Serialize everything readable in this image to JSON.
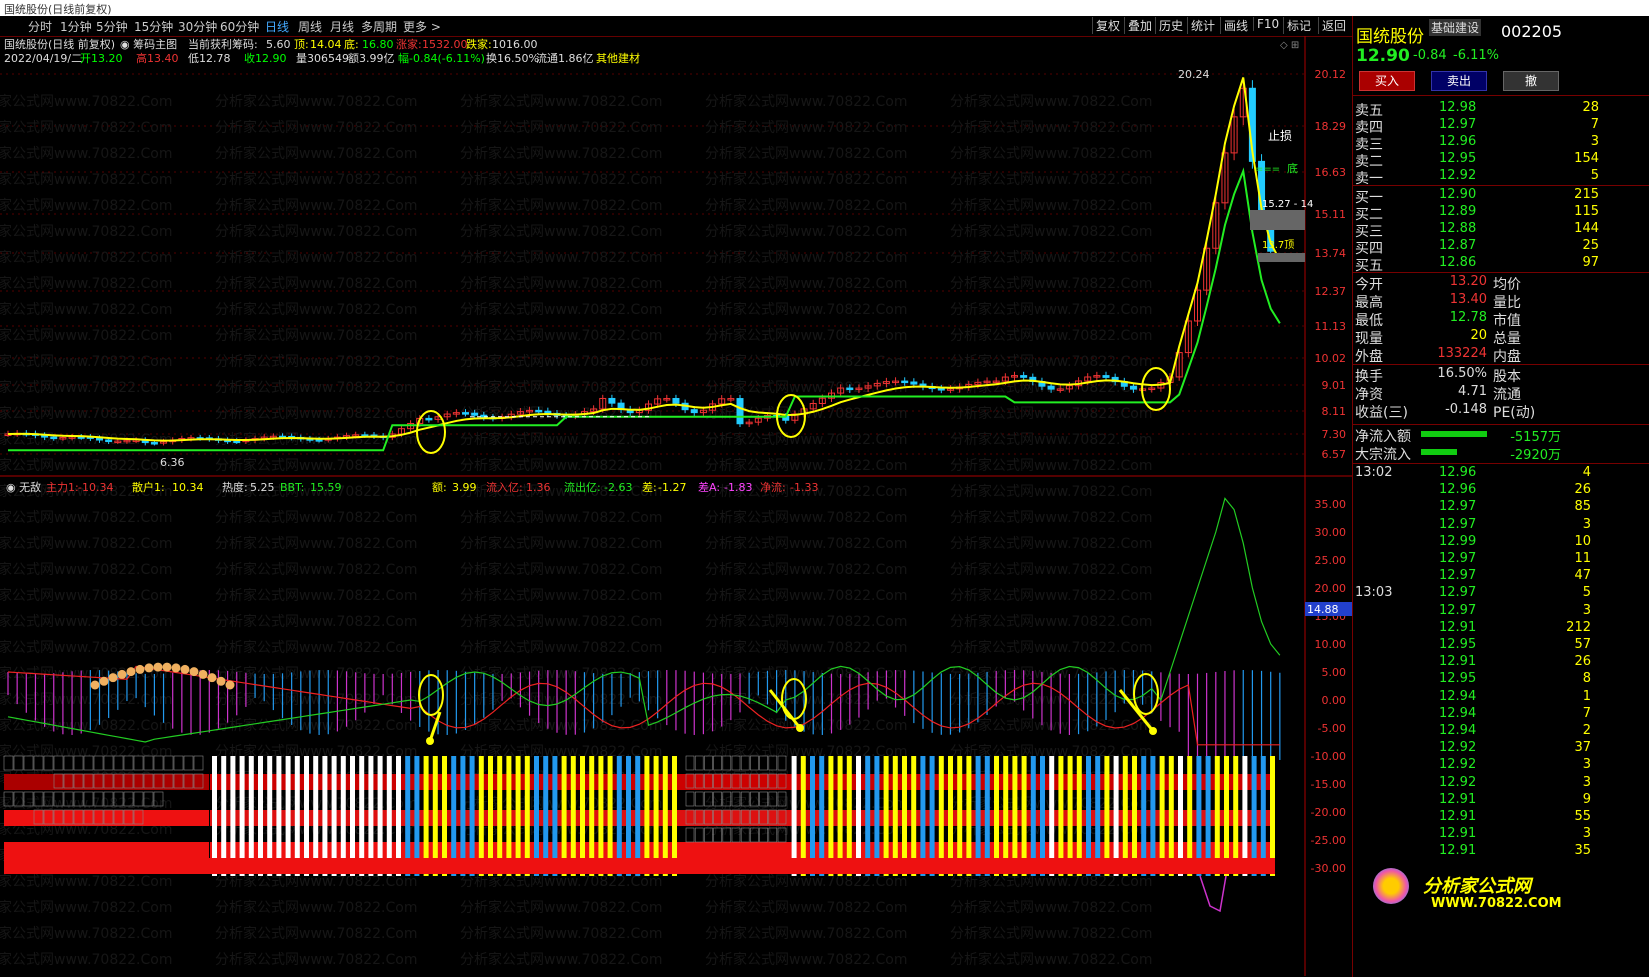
{
  "window_title": "国统股份(日线前复权)",
  "periods": [
    "分时",
    "1分钟",
    "5分钟",
    "15分钟",
    "30分钟",
    "60分钟",
    "日线",
    "周线",
    "月线",
    "多周期",
    "更多 >"
  ],
  "active_period": "日线",
  "tools": [
    "复权",
    "叠加",
    "历史",
    "统计",
    "画线",
    "F10",
    "标记",
    "返回"
  ],
  "header": {
    "stock": "国统股份(日线 前复权)",
    "indicator": "筹码主图",
    "chip_label": "当前获利筹码:",
    "chip_val": "5.60",
    "top_label": "顶:",
    "top_val": "14.04",
    "bottom_label": "底:",
    "bottom_val": "16.80",
    "up_label": "涨家:",
    "up_val": "1532.00",
    "down_label": "跌家:",
    "down_val": "1016.00",
    "date": "2022/04/19/二",
    "open": "开13.20",
    "high": "高13.40",
    "low": "低12.78",
    "close": "收12.90",
    "vol": "量306549",
    "amt": "额3.99亿",
    "chg": "幅-0.84(-6.11%)",
    "turnover": "换16.50%",
    "float": "流通1.86亿",
    "sector": "其他建材"
  },
  "price_axis": [
    "20.12",
    "18.29",
    "16.63",
    "15.11",
    "13.74",
    "12.37",
    "11.13",
    "10.02",
    "9.01",
    "8.11",
    "7.30",
    "6.57"
  ],
  "chart_labels": {
    "peak": "20.24",
    "low": "6.36",
    "stop": "止损",
    "bottom_tag": "底",
    "band1": "15.27 - 14",
    "band2": "13.7顶"
  },
  "indicator_header": {
    "name": "无敌",
    "main_label": "主力1:",
    "main_val": "-10.34",
    "retail_label": "散户1:",
    "retail_val": "10.34",
    "heat_label": "热度:",
    "heat_val": "5.25",
    "bbt_label": "BBT:",
    "bbt_val": "15.59",
    "amt_label": "额:",
    "amt_val": "3.99",
    "inflow_label": "流入亿:",
    "inflow_val": "1.36",
    "outflow_label": "流出亿:",
    "outflow_val": "-2.63",
    "diff_label": "差:",
    "diff_val": "-1.27",
    "diffA_label": "差A:",
    "diffA_val": "-1.83",
    "net_label": "净流:",
    "net_val": "-1.33"
  },
  "indicator_axis": [
    "35.00",
    "30.00",
    "25.00",
    "20.00",
    "15.00",
    "10.00",
    "5.00",
    "0.00",
    "-5.00",
    "-10.00",
    "-15.00",
    "-20.00",
    "-25.00",
    "-30.00"
  ],
  "indicator_marker": "14.88",
  "right_panel": {
    "name": "国统股份",
    "sector": "基础建设",
    "code": "002205",
    "price": "12.90",
    "chg": "-0.84",
    "pct": "-6.11%",
    "buy_btn": "买入",
    "sell_btn": "卖出",
    "cancel_btn": "撤",
    "asks": [
      {
        "l": "卖五",
        "p": "12.98",
        "v": "28"
      },
      {
        "l": "卖四",
        "p": "12.97",
        "v": "7"
      },
      {
        "l": "卖三",
        "p": "12.96",
        "v": "3"
      },
      {
        "l": "卖二",
        "p": "12.95",
        "v": "154"
      },
      {
        "l": "卖一",
        "p": "12.92",
        "v": "5"
      }
    ],
    "bids": [
      {
        "l": "买一",
        "p": "12.90",
        "v": "215"
      },
      {
        "l": "买二",
        "p": "12.89",
        "v": "115"
      },
      {
        "l": "买三",
        "p": "12.88",
        "v": "144"
      },
      {
        "l": "买四",
        "p": "12.87",
        "v": "25"
      },
      {
        "l": "买五",
        "p": "12.86",
        "v": "97"
      }
    ],
    "stats": [
      {
        "l": "今开",
        "v": "13.20",
        "l2": "均价"
      },
      {
        "l": "最高",
        "v": "13.40",
        "l2": "量比"
      },
      {
        "l": "最低",
        "v": "12.78",
        "l2": "市值"
      },
      {
        "l": "现量",
        "v": "20",
        "l2": "总量"
      },
      {
        "l": "外盘",
        "v": "133224",
        "l2": "内盘"
      }
    ],
    "stats2": [
      {
        "l": "换手",
        "v": "16.50%",
        "l2": "股本"
      },
      {
        "l": "净资",
        "v": "4.71",
        "l2": "流通"
      },
      {
        "l": "收益(三)",
        "v": "-0.148",
        "l2": "PE(动)"
      }
    ],
    "flows": [
      {
        "l": "净流入额",
        "v": "-5157万"
      },
      {
        "l": "大宗流入",
        "v": "-2920万"
      }
    ],
    "ticks": [
      {
        "t": "13:02",
        "p": "12.96",
        "v": "4"
      },
      {
        "t": "",
        "p": "12.96",
        "v": "26"
      },
      {
        "t": "",
        "p": "12.97",
        "v": "85"
      },
      {
        "t": "",
        "p": "12.97",
        "v": "3"
      },
      {
        "t": "",
        "p": "12.99",
        "v": "10"
      },
      {
        "t": "",
        "p": "12.97",
        "v": "11"
      },
      {
        "t": "",
        "p": "12.97",
        "v": "47"
      },
      {
        "t": "13:03",
        "p": "12.97",
        "v": "5"
      },
      {
        "t": "",
        "p": "12.97",
        "v": "3"
      },
      {
        "t": "",
        "p": "12.91",
        "v": "212"
      },
      {
        "t": "",
        "p": "12.95",
        "v": "57"
      },
      {
        "t": "",
        "p": "12.91",
        "v": "26"
      },
      {
        "t": "",
        "p": "12.95",
        "v": "8"
      },
      {
        "t": "",
        "p": "12.94",
        "v": "1"
      },
      {
        "t": "",
        "p": "12.94",
        "v": "7"
      },
      {
        "t": "",
        "p": "12.94",
        "v": "2"
      },
      {
        "t": "",
        "p": "12.92",
        "v": "37"
      },
      {
        "t": "",
        "p": "12.92",
        "v": "3"
      },
      {
        "t": "",
        "p": "12.92",
        "v": "3"
      },
      {
        "t": "",
        "p": "12.91",
        "v": "9"
      },
      {
        "t": "",
        "p": "12.91",
        "v": "55"
      },
      {
        "t": "",
        "p": "12.91",
        "v": "3"
      },
      {
        "t": "",
        "p": "12.91",
        "v": "35"
      }
    ],
    "logo": "分析家公式网",
    "logo_url": "WWW.70822.COM"
  },
  "watermark": "分析家公式网www.70822.Com"
}
